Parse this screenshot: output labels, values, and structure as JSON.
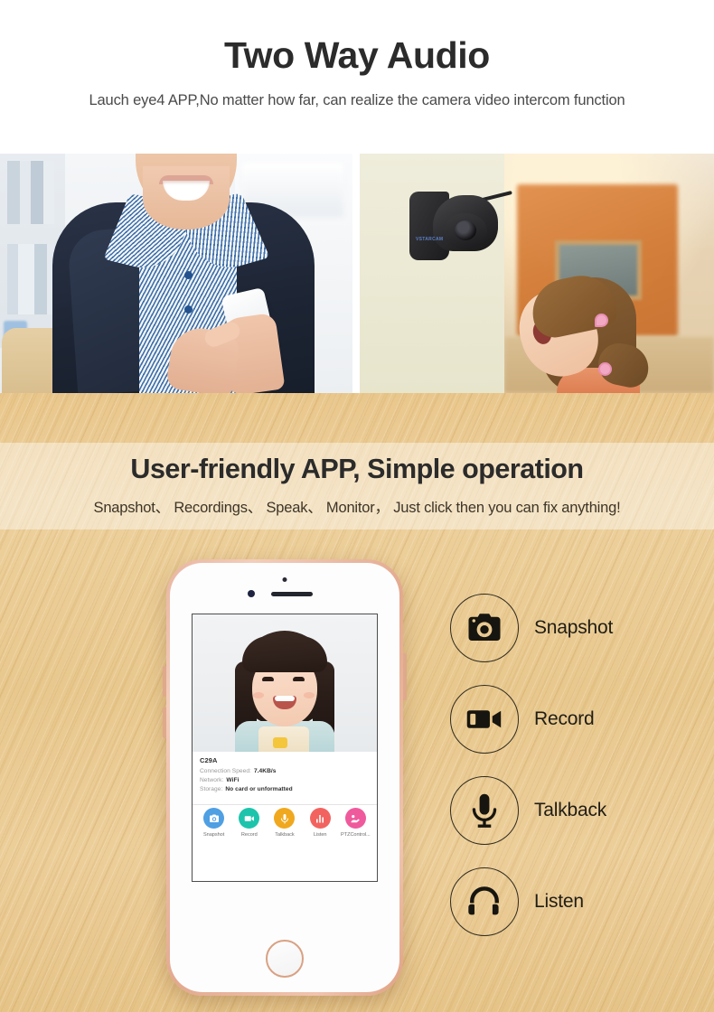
{
  "hero": {
    "title": "Two Way Audio",
    "subtitle": "Lauch eye4 APP,No matter how far, can realize the camera video intercom function"
  },
  "photos": {
    "left": {
      "alt": "smiling-woman-using-smartphone-in-office"
    },
    "right": {
      "alt": "wall-mounted-black-ptz-camera-and-girl-looking-up",
      "camera_brand": "VSTARCAM"
    }
  },
  "wood_section": {
    "title": "User-friendly APP, Simple operation",
    "subtitle": "Snapshot、 Recordings、 Speak、 Monitor， Just click then you can fix anything!"
  },
  "phone_app": {
    "video_alt": "smiling-young-girl-live-view",
    "device_name": "C29A",
    "info_rows": [
      {
        "label": "Connection Speed:",
        "value": "7.4KB/s"
      },
      {
        "label": "Network:",
        "value": "WiFi"
      },
      {
        "label": "Storage:",
        "value": "No card or unformatted"
      }
    ],
    "toolbar": [
      {
        "label": "Snapshot",
        "icon": "camera-icon",
        "color": "#4f9fe3"
      },
      {
        "label": "Record",
        "icon": "video-icon",
        "color": "#1dc4ab"
      },
      {
        "label": "Talkback",
        "icon": "microphone-icon",
        "color": "#f0a81e"
      },
      {
        "label": "Listen",
        "icon": "bars-icon",
        "color": "#f2635f"
      },
      {
        "label": "PTZControl...",
        "icon": "ptz-icon",
        "color": "#ef5a9c"
      }
    ]
  },
  "features": [
    {
      "label": "Snapshot",
      "icon": "camera-icon"
    },
    {
      "label": "Record",
      "icon": "video-icon"
    },
    {
      "label": "Talkback",
      "icon": "microphone-icon"
    },
    {
      "label": "Listen",
      "icon": "headphones-icon"
    }
  ],
  "colors": {
    "wood": "#e8c88d",
    "band_overlay": "#ffffff",
    "heading": "#2b2b2b"
  }
}
